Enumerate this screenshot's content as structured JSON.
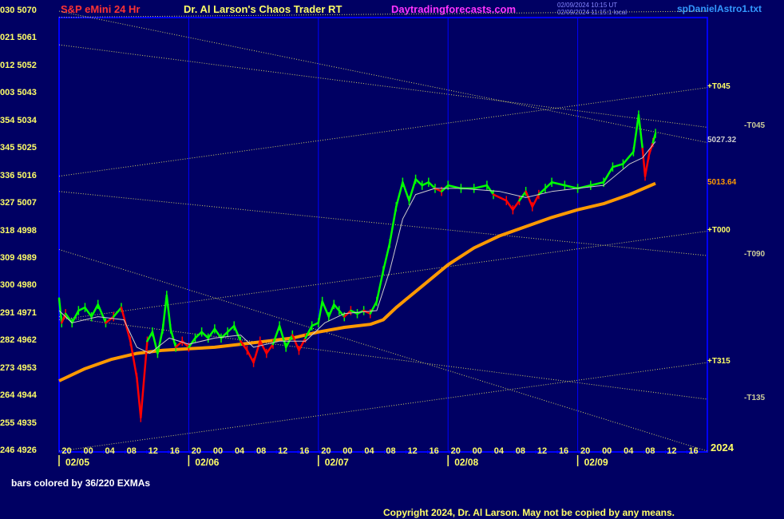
{
  "header": {
    "title_left": "S&P eMini 24 Hr",
    "title_center": "Dr. Al Larson's Chaos Trader RT",
    "site": "Daytradingforecasts.com",
    "timestamp_line1": "02/09/2024 10:15 UT",
    "timestamp_line2": "02/09/2024 11:15:1 local",
    "file": "spDanielAstro1.txt"
  },
  "chart_data": {
    "type": "line",
    "title": "S&P eMini 24 Hr",
    "year_label": "2024",
    "ylim": [
      4926,
      5070
    ],
    "y_ticks": [
      {
        "deg": "030",
        "price": 5070
      },
      {
        "deg": "021",
        "price": 5061
      },
      {
        "deg": "012",
        "price": 5052
      },
      {
        "deg": "003",
        "price": 5043
      },
      {
        "deg": "354",
        "price": 5034
      },
      {
        "deg": "345",
        "price": 5025
      },
      {
        "deg": "336",
        "price": 5016
      },
      {
        "deg": "327",
        "price": 5007
      },
      {
        "deg": "318",
        "price": 4998
      },
      {
        "deg": "309",
        "price": 4989
      },
      {
        "deg": "300",
        "price": 4980
      },
      {
        "deg": "291",
        "price": 4971
      },
      {
        "deg": "282",
        "price": 4962
      },
      {
        "deg": "273",
        "price": 4953
      },
      {
        "deg": "264",
        "price": 4944
      },
      {
        "deg": "255",
        "price": 4935
      },
      {
        "deg": "246",
        "price": 4926
      }
    ],
    "x_range_days": [
      0,
      5
    ],
    "date_labels": [
      "02/05",
      "02/06",
      "02/07",
      "02/08",
      "02/09"
    ],
    "hour_labels": [
      "20",
      "00",
      "04",
      "08",
      "12",
      "16"
    ],
    "price_series": [
      [
        0.0,
        4976
      ],
      [
        0.02,
        4968
      ],
      [
        0.05,
        4971
      ],
      [
        0.1,
        4968
      ],
      [
        0.15,
        4972
      ],
      [
        0.2,
        4973
      ],
      [
        0.25,
        4970
      ],
      [
        0.3,
        4974
      ],
      [
        0.36,
        4968
      ],
      [
        0.42,
        4970
      ],
      [
        0.48,
        4973
      ],
      [
        0.55,
        4962
      ],
      [
        0.6,
        4950
      ],
      [
        0.63,
        4937
      ],
      [
        0.68,
        4962
      ],
      [
        0.72,
        4965
      ],
      [
        0.76,
        4958
      ],
      [
        0.8,
        4966
      ],
      [
        0.83,
        4977
      ],
      [
        0.86,
        4966
      ],
      [
        0.9,
        4960
      ],
      [
        0.95,
        4962
      ],
      [
        1.0,
        4960
      ],
      [
        1.05,
        4963
      ],
      [
        1.1,
        4965
      ],
      [
        1.15,
        4963
      ],
      [
        1.2,
        4966
      ],
      [
        1.25,
        4963
      ],
      [
        1.3,
        4965
      ],
      [
        1.35,
        4967
      ],
      [
        1.4,
        4962
      ],
      [
        1.45,
        4959
      ],
      [
        1.5,
        4955
      ],
      [
        1.55,
        4962
      ],
      [
        1.6,
        4958
      ],
      [
        1.65,
        4961
      ],
      [
        1.7,
        4967
      ],
      [
        1.75,
        4960
      ],
      [
        1.8,
        4964
      ],
      [
        1.85,
        4959
      ],
      [
        1.9,
        4963
      ],
      [
        1.95,
        4967
      ],
      [
        2.0,
        4968
      ],
      [
        2.03,
        4975
      ],
      [
        2.08,
        4970
      ],
      [
        2.12,
        4974
      ],
      [
        2.16,
        4972
      ],
      [
        2.2,
        4970
      ],
      [
        2.25,
        4972
      ],
      [
        2.3,
        4971
      ],
      [
        2.35,
        4972
      ],
      [
        2.4,
        4971
      ],
      [
        2.45,
        4975
      ],
      [
        2.5,
        4985
      ],
      [
        2.55,
        4994
      ],
      [
        2.6,
        5006
      ],
      [
        2.65,
        5014
      ],
      [
        2.7,
        5008
      ],
      [
        2.75,
        5015
      ],
      [
        2.8,
        5013
      ],
      [
        2.85,
        5014
      ],
      [
        2.9,
        5012
      ],
      [
        2.95,
        5011
      ],
      [
        3.0,
        5013
      ],
      [
        3.1,
        5012
      ],
      [
        3.2,
        5012
      ],
      [
        3.3,
        5013
      ],
      [
        3.35,
        5010
      ],
      [
        3.45,
        5008
      ],
      [
        3.5,
        5005
      ],
      [
        3.55,
        5008
      ],
      [
        3.6,
        5011
      ],
      [
        3.65,
        5006
      ],
      [
        3.7,
        5010
      ],
      [
        3.75,
        5012
      ],
      [
        3.8,
        5014
      ],
      [
        3.9,
        5013
      ],
      [
        4.0,
        5012
      ],
      [
        4.1,
        5013
      ],
      [
        4.2,
        5014
      ],
      [
        4.27,
        5019
      ],
      [
        4.35,
        5020
      ],
      [
        4.43,
        5024
      ],
      [
        4.47,
        5036
      ],
      [
        4.5,
        5025
      ],
      [
        4.52,
        5016
      ],
      [
        4.55,
        5023
      ],
      [
        4.58,
        5027
      ],
      [
        4.6,
        5030
      ]
    ],
    "ema220_series": [
      [
        0.0,
        4949
      ],
      [
        0.2,
        4953
      ],
      [
        0.4,
        4956
      ],
      [
        0.6,
        4958
      ],
      [
        0.8,
        4959
      ],
      [
        1.0,
        4959.5
      ],
      [
        1.2,
        4960
      ],
      [
        1.4,
        4961
      ],
      [
        1.6,
        4962
      ],
      [
        1.8,
        4963
      ],
      [
        2.0,
        4965
      ],
      [
        2.2,
        4966.5
      ],
      [
        2.4,
        4967.5
      ],
      [
        2.5,
        4969
      ],
      [
        2.6,
        4973
      ],
      [
        2.8,
        4980
      ],
      [
        3.0,
        4987
      ],
      [
        3.2,
        4992.5
      ],
      [
        3.4,
        4996.5
      ],
      [
        3.6,
        4999.5
      ],
      [
        3.8,
        5002.5
      ],
      [
        4.0,
        5005
      ],
      [
        4.2,
        5007
      ],
      [
        4.4,
        5010
      ],
      [
        4.6,
        5013.64
      ]
    ],
    "ema36_series": [
      [
        0.0,
        4972
      ],
      [
        0.1,
        4968
      ],
      [
        0.3,
        4970
      ],
      [
        0.5,
        4969
      ],
      [
        0.6,
        4960
      ],
      [
        0.7,
        4958
      ],
      [
        0.85,
        4963
      ],
      [
        1.0,
        4961
      ],
      [
        1.2,
        4963
      ],
      [
        1.4,
        4964
      ],
      [
        1.5,
        4960
      ],
      [
        1.7,
        4962
      ],
      [
        1.9,
        4962
      ],
      [
        2.05,
        4968
      ],
      [
        2.2,
        4971
      ],
      [
        2.45,
        4972
      ],
      [
        2.55,
        4985
      ],
      [
        2.65,
        5002
      ],
      [
        2.75,
        5010
      ],
      [
        2.9,
        5012
      ],
      [
        3.1,
        5012
      ],
      [
        3.4,
        5011
      ],
      [
        3.6,
        5009
      ],
      [
        3.8,
        5011
      ],
      [
        4.0,
        5012
      ],
      [
        4.2,
        5013
      ],
      [
        4.4,
        5020
      ],
      [
        4.5,
        5022
      ],
      [
        4.6,
        5027.32
      ]
    ],
    "price_readouts": [
      {
        "label": "5027.32",
        "price": 5027.32,
        "color": "#cccccc"
      },
      {
        "label": "5013.64",
        "price": 5013.64,
        "color": "#ff9900"
      }
    ],
    "planet_lines": [
      {
        "label": "+T045",
        "price": 5045,
        "start_day": 0,
        "start_price": 5016
      },
      {
        "label": "-T045",
        "price": 5032,
        "start_day": 0,
        "start_price": 5059
      },
      {
        "label": "+T000",
        "price": 4998,
        "start_day": 0,
        "start_price": 4969
      },
      {
        "label": "-T090",
        "price": 4990,
        "start_day": 0,
        "start_price": 5011
      },
      {
        "label": "+T315",
        "price": 4955,
        "start_day": 0,
        "start_price": 4926
      },
      {
        "label": "-T135",
        "price": 4943,
        "start_day": 0,
        "start_price": 4970
      },
      {
        "label": "",
        "price": 5070,
        "start_day": 0,
        "start_price": 5068
      },
      {
        "label": "",
        "price": 5027,
        "start_day": 0,
        "start_price": 5070
      },
      {
        "label": "",
        "price": 4926,
        "start_day": 0,
        "start_price": 4992
      }
    ],
    "colors": {
      "background": "#000063",
      "grid": "#0000ff",
      "frame": "#0000ff",
      "up_bars": "#00ff00",
      "down_bars": "#ff0000",
      "ema220": "#ff9900",
      "ema36": "#cccccc",
      "planet_lines": "#cccc66",
      "axis_text": "#ffff66"
    }
  },
  "footer": {
    "note": "bars colored by 36/220 EXMAs",
    "copyright": "Copyright 2024, Dr. Al Larson. May not be copied by any means."
  }
}
